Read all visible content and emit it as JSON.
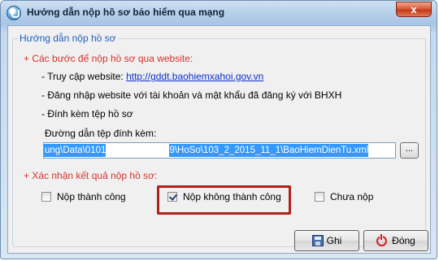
{
  "window": {
    "title": "Hướng dẫn nộp hồ sơ bảo hiểm qua mạng",
    "close_label": "x"
  },
  "group": {
    "legend": "Hướng dẫn nộp hồ sơ"
  },
  "steps": {
    "heading": "+ Các bước để nộp hồ sơ qua website:",
    "step1_prefix": "- Truy cập website:",
    "step1_link": "http://gddt.baohiemxahoi.gov.vn",
    "step2": "- Đăng nhập website với tài khoản và mật khẩu đã đăng ký với BHXH",
    "step3": "- Đính kèm tệp hồ sơ",
    "path_label": "Đường dẫn tệp đính kèm:",
    "path_part1": "ung\\Data\\0101",
    "path_part2": "9\\HoSo\\103_2_2015_11_1\\BaoHiemDienTu.xml",
    "browse_label": "..."
  },
  "result": {
    "heading": "+ Xác nhận kết quả nộp hồ sơ:",
    "options": [
      {
        "label": "Nộp thành công",
        "checked": false
      },
      {
        "label": "Nộp không thành công",
        "checked": true
      },
      {
        "label": "Chưa nộp",
        "checked": false
      }
    ]
  },
  "buttons": {
    "save_label": "Ghi",
    "close_label": "Đóng"
  }
}
